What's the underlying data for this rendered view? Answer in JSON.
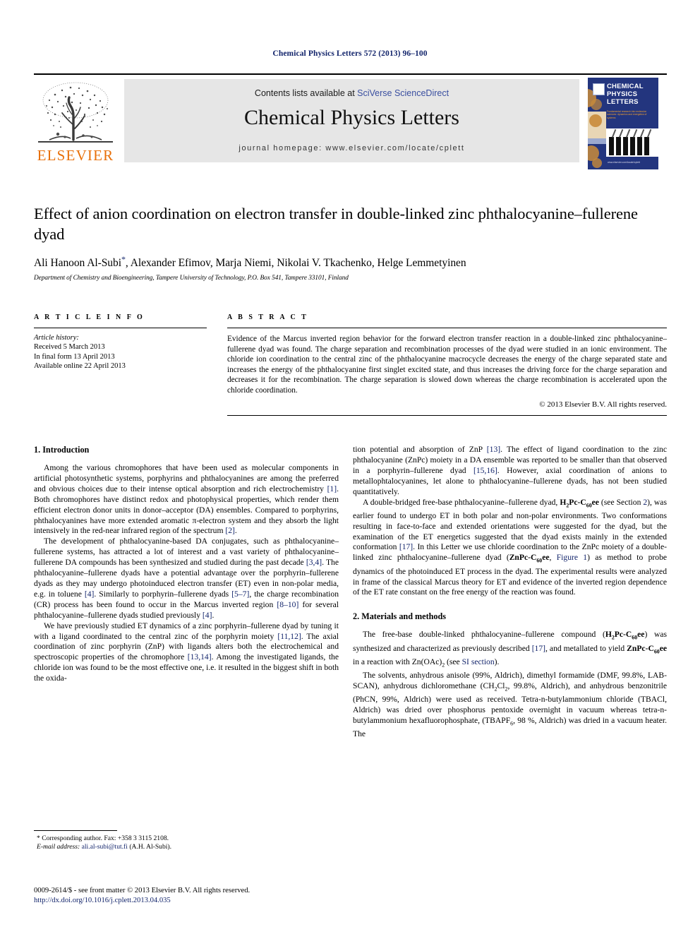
{
  "running_head": "Chemical Physics Letters 572 (2013) 96–100",
  "masthead": {
    "publisher_name": "ELSEVIER",
    "contents_prefix": "Contents lists available at ",
    "contents_link": "SciVerse ScienceDirect",
    "journal_title": "Chemical Physics Letters",
    "homepage": "journal homepage: www.elsevier.com/locate/cplett",
    "cover": {
      "title_line1": "CHEMICAL",
      "title_line2": "PHYSICS",
      "title_line3": "LETTERS",
      "subtitle": "Fundamental research into molecular sciences: dynamics and energetics of systems",
      "footer": "www.elsevier.com/locate/cplett"
    }
  },
  "article": {
    "title": "Effect of anion coordination on electron transfer in double-linked zinc phthalocyanine–fullerene dyad",
    "authors": "Ali Hanoon Al-Subi",
    "authors_rest": ", Alexander Efimov, Marja Niemi, Nikolai V. Tkachenko, Helge Lemmetyinen",
    "corresponding_mark": "*",
    "affiliation": "Department of Chemistry and Bioengineering, Tampere University of Technology, P.O. Box 541, Tampere 33101, Finland"
  },
  "article_info": {
    "heading": "A R T I C L E   I N F O",
    "history_label": "Article history:",
    "received": "Received 5 March 2013",
    "final_form": "In final form 13 April 2013",
    "available_online": "Available online 22 April 2013"
  },
  "abstract": {
    "heading": "A B S T R A C T",
    "text": "Evidence of the Marcus inverted region behavior for the forward electron transfer reaction in a double-linked zinc phthalocyanine–fullerene dyad was found. The charge separation and recombination processes of the dyad were studied in an ionic environment. The chloride ion coordination to the central zinc of the phthalocyanine macrocycle decreases the energy of the charge separated state and increases the energy of the phthalocyanine first singlet excited state, and thus increases the driving force for the charge separation and decreases it for the recombination. The charge separation is slowed down whereas the charge recombination is accelerated upon the chloride coordination.",
    "copyright": "© 2013 Elsevier B.V. All rights reserved."
  },
  "sections": {
    "introduction_heading": "1. Introduction",
    "materials_heading": "2. Materials and methods"
  },
  "body": {
    "p1_a": "Among the various chromophores that have been used as molecular components in artificial photosynthetic systems, porphyrins and phthalocyanines are among the preferred and obvious choices due to their intense optical absorption and rich electrochemistry ",
    "p1_ref1": "[1]",
    "p1_b": ". Both chromophores have distinct redox and photophysical properties, which render them efficient electron donor units in donor–acceptor (DA) ensembles. Compared to porphyrins, phthalocyanines have more extended aromatic π-electron system and they absorb the light intensively in the red-near infrared region of the spectrum ",
    "p1_ref2": "[2]",
    "p1_c": ".",
    "p2_a": "The development of phthalocyanine-based DA conjugates, such as phthalocyanine–fullerene systems, has attracted a lot of interest and a vast variety of phthalocyanine–fullerene DA compounds has been synthesized and studied during the past decade ",
    "p2_ref1": "[3,4]",
    "p2_b": ". The phthalocyanine–fullerene dyads have a potential advantage over the porphyrin–fullerene dyads as they may undergo photoinduced electron transfer (ET) even in non-polar media, e.g. in toluene ",
    "p2_ref2": "[4]",
    "p2_c": ". Similarly to porphyrin–fullerene dyads ",
    "p2_ref3": "[5–7]",
    "p2_d": ", the charge recombination (CR) process has been found to occur in the Marcus inverted region ",
    "p2_ref4": "[8–10]",
    "p2_e": " for several phthalocyanine–fullerene dyads studied previously ",
    "p2_ref5": "[4]",
    "p2_f": ".",
    "p3_a": "We have previously studied ET dynamics of a zinc porphyrin–fullerene dyad by tuning it with a ligand coordinated to the central zinc of the porphyrin moiety ",
    "p3_ref1": "[11,12]",
    "p3_b": ". The axial coordination of zinc porphyrin (ZnP) with ligands alters both the electrochemical and spectroscopic properties of the chromophore ",
    "p3_ref2": "[13,14]",
    "p3_c": ". Among the investigated ligands, the chloride ion was found to be the most effective one, i.e. it resulted in the biggest shift in both the oxida-",
    "p4_a": "tion potential and absorption of ZnP ",
    "p4_ref1": "[13]",
    "p4_b": ". The effect of ligand coordination to the zinc phthalocyanine (ZnPc) moiety in a DA ensemble was reported to be smaller than that observed in a porphyrin–fullerene dyad ",
    "p4_ref2": "[15,16]",
    "p4_c": ". However, axial coordination of anions to metallophtalocyanines, let alone to phthalocyanine–fullerene dyads, has not been studied quantitatively.",
    "p5_a": "A double-bridged free-base phthalocyanine–fullerene dyad, ",
    "p5_compound1_pre": "H",
    "p5_compound1_sub1": "2",
    "p5_compound1_mid": "Pc-C",
    "p5_compound1_sub2": "60",
    "p5_compound1_post": "ee",
    "p5_b": " (see Section ",
    "p5_ref1": "2",
    "p5_c": "), was earlier found to undergo ET in both polar and non-polar environments. Two conformations resulting in face-to-face and extended orientations were suggested for the dyad, but the examination of the ET energetics suggested that the dyad exists mainly in the extended conformation ",
    "p5_ref2": "[17]",
    "p5_d": ". In this Letter we use chloride coordination to the ZnPc moiety of a double-linked zinc phthalocyanine–fullerene dyad (",
    "p5_compound2_pre": "ZnPc-C",
    "p5_compound2_sub": "60",
    "p5_compound2_post": "ee",
    "p5_e": ", ",
    "p5_ref3": "Figure 1",
    "p5_f": ") as method to probe dynamics of the photoinduced ET process in the dyad. The experimental results were analyzed in frame of the classical Marcus theory for ET and evidence of the inverted region dependence of the ET rate constant on the free energy of the reaction was found.",
    "p6_a": "The free-base double-linked phthalocyanine–fullerene compound (",
    "p6_compound1_pre": "H",
    "p6_compound1_sub1": "2",
    "p6_compound1_mid": "Pc-C",
    "p6_compound1_sub2": "60",
    "p6_compound1_post": "ee",
    "p6_b": ") was synthesized and characterized as previously described ",
    "p6_ref1": "[17]",
    "p6_c": ", and metallated to yield ",
    "p6_compound2_pre": "ZnPc-C",
    "p6_compound2_sub": "60",
    "p6_compound2_post": "ee",
    "p6_d": " in a reaction with Zn(OAc)",
    "p6_sub": "2",
    "p6_e": " (see ",
    "p6_ref2": "SI section",
    "p6_f": ").",
    "p7_a": "The solvents, anhydrous anisole (99%, Aldrich), dimethyl formamide (DMF, 99.8%, LAB-SCAN), anhydrous dichloromethane (CH",
    "p7_sub1": "2",
    "p7_b": "Cl",
    "p7_sub2": "2",
    "p7_c": ", 99.8%, Aldrich), and anhydrous benzonitrile (PhCN, 99%, Aldrich) were used as received. Tetra-n-butylammonium chloride (TBACl, Aldrich) was dried over phosphorus pentoxide overnight in vacuum whereas tetra-n-butylammonium hexafluorophosphate, (TBAPF",
    "p7_sub3": "6",
    "p7_d": ", 98 %, Aldrich) was dried in a vacuum heater. The"
  },
  "footnote": {
    "corr_mark": "*",
    "corr_text": " Corresponding author. Fax: +358 3 3115 2108.",
    "email_label": "E-mail address:",
    "email": " ali.al-subi@tut.fi",
    "email_suffix": " (A.H. Al-Subi)."
  },
  "footer": {
    "issn_line": "0009-2614/$ - see front matter © 2013 Elsevier B.V. All rights reserved.",
    "doi": "http://dx.doi.org/10.1016/j.cplett.2013.04.035"
  },
  "colors": {
    "link": "#12246b",
    "elsevier_orange": "#E8700A",
    "banner_gray": "#e6e6e6",
    "cover_blue": "#23357e"
  }
}
